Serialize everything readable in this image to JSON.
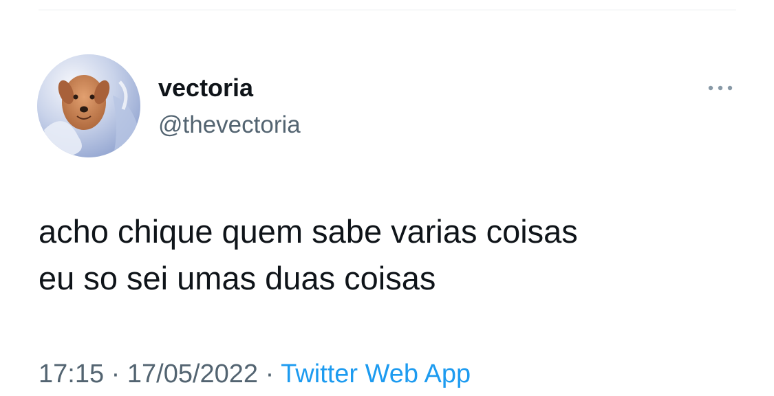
{
  "tweet": {
    "author": {
      "display_name": "vectoria",
      "handle": "@thevectoria",
      "avatar_icon": "avatar-dog-photo"
    },
    "more_icon": "more-horizontal-icon",
    "text": "acho chique quem sabe varias coisas\neu so sei umas duas coisas",
    "time": "17:15",
    "separator": "·",
    "date": "17/05/2022",
    "source": "Twitter Web App"
  },
  "colors": {
    "primary_text": "#0f1419",
    "secondary_text": "#536471",
    "link": "#1d9bf0",
    "divider": "#e8ecee"
  }
}
